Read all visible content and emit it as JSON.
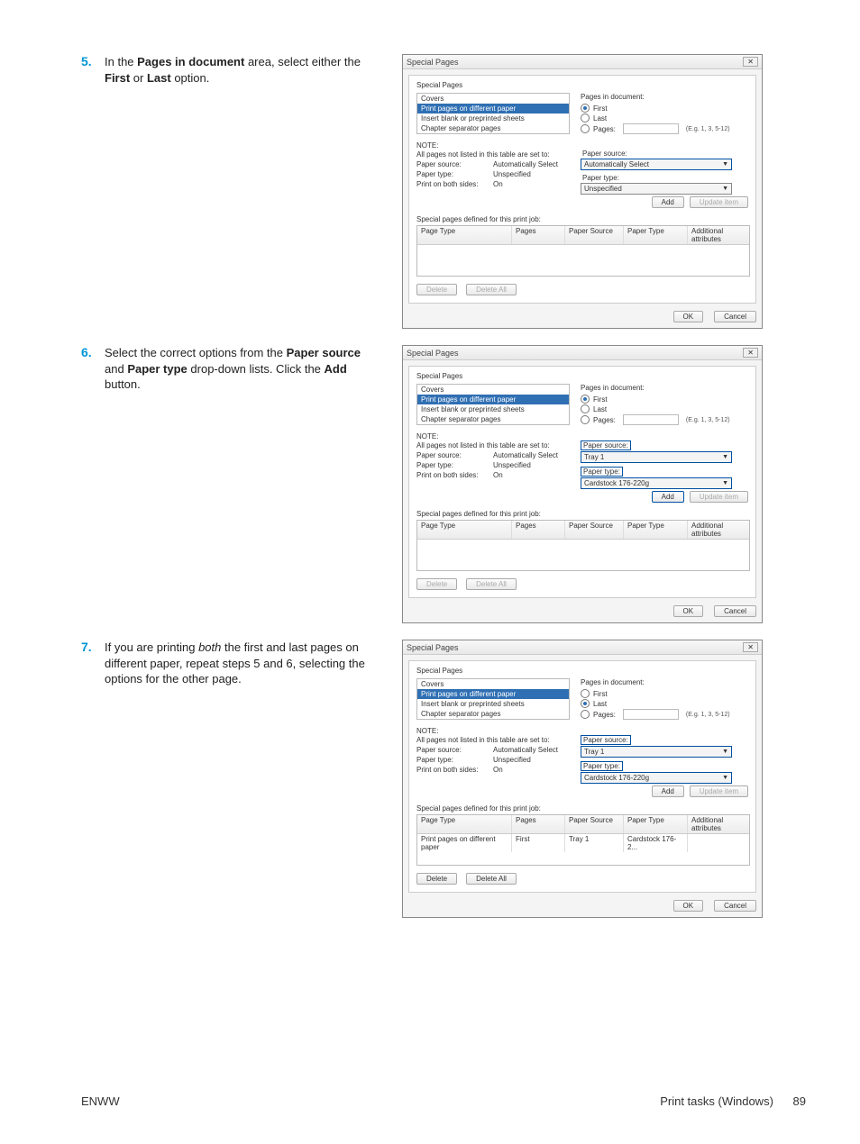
{
  "footer": {
    "left": "ENWW",
    "rightText": "Print tasks (Windows)",
    "pageNum": "89"
  },
  "steps": {
    "s5": {
      "num": "5.",
      "pre": "In the ",
      "b1": "Pages in document",
      "mid": " area, select either the ",
      "b2": "First",
      "or": " or ",
      "b3": "Last",
      "post": " option."
    },
    "s6": {
      "num": "6.",
      "pre": "Select the correct options from the ",
      "b1": "Paper source",
      "and": " and ",
      "b2": "Paper type",
      "mid": " drop-down lists. Click the ",
      "b3": "Add",
      "post": " button."
    },
    "s7": {
      "num": "7.",
      "pre": "If you are printing ",
      "i1": "both",
      "mid": " the first and last pages on different paper, repeat steps 5 and 6, selecting the options for the other page."
    }
  },
  "labels": {
    "title": "Special Pages",
    "sectionTitle": "Special Pages",
    "covers": "Covers",
    "ppodp": "Print pages on different paper",
    "insertBlank": "Insert blank or preprinted sheets",
    "chapterSep": "Chapter separator pages",
    "pagesInDoc": "Pages in document:",
    "first": "First",
    "last": "Last",
    "pages": "Pages:",
    "eg": "(E.g. 1, 3, 5-12)",
    "noteTitle": "NOTE:",
    "noteText": "All pages not listed in this table are set to:",
    "paperSource": "Paper source:",
    "paperType": "Paper type:",
    "printBoth": "Print on both sides:",
    "autoSel": "Automatically Select",
    "unspec": "Unspecified",
    "on": "On",
    "add": "Add",
    "updateItem": "Update item",
    "spDefined": "Special pages defined for this print job:",
    "thPageType": "Page Type",
    "thPages": "Pages",
    "thPaperSource": "Paper Source",
    "thPaperType": "Paper Type",
    "thAddAttr": "Additional attributes",
    "delete": "Delete",
    "deleteAll": "Delete All",
    "ok": "OK",
    "cancel": "Cancel",
    "tray1": "Tray 1",
    "cardstock": "Cardstock 176-220g",
    "tableRowType": "Print pages on different paper",
    "tableRowPages": "First",
    "tableRowSource": "Tray 1",
    "tableRowPaperType": "Cardstock 176-2..."
  },
  "dlg1": {
    "firstOn": true,
    "lastOn": false,
    "srcDrop": "Automatically Select",
    "typeDrop": "Unspecified",
    "srcHL": true,
    "typeHL": false,
    "addHL": false,
    "hasRow": false,
    "psHL": false,
    "ptHL": false
  },
  "dlg2": {
    "firstOn": true,
    "lastOn": false,
    "srcDrop": "Tray 1",
    "typeDrop": "Cardstock 176-220g",
    "srcHL": true,
    "typeHL": true,
    "addHL": true,
    "hasRow": false,
    "psHL": true,
    "ptHL": true
  },
  "dlg3": {
    "firstOn": false,
    "lastOn": true,
    "srcDrop": "Tray 1",
    "typeDrop": "Cardstock 176-220g",
    "srcHL": true,
    "typeHL": true,
    "addHL": false,
    "hasRow": true,
    "psHL": true,
    "ptHL": true
  }
}
